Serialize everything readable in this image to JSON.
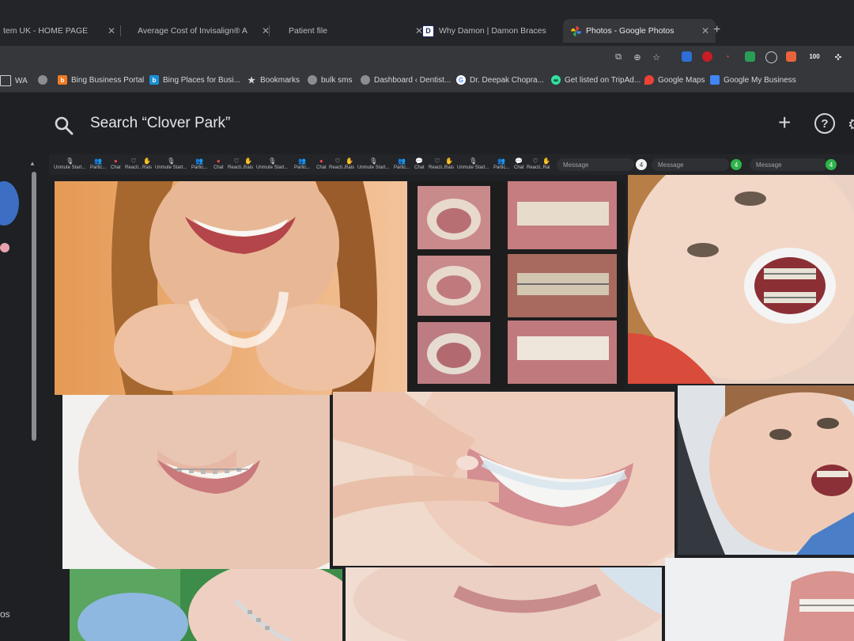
{
  "tabs": [
    {
      "title": "tem UK - HOME PAGE",
      "favicon": "generic"
    },
    {
      "title": "Average Cost of Invisalign® A",
      "favicon": "none"
    },
    {
      "title": "Patient file",
      "favicon": "none"
    },
    {
      "title": "Why Damon | Damon Braces",
      "favicon": "D"
    },
    {
      "title": "Photos - Google Photos",
      "favicon": "photos",
      "active": true
    }
  ],
  "bookmarks": [
    {
      "label": "WA",
      "icon": "folder-icon"
    },
    {
      "label": "",
      "icon": "globe-icon"
    },
    {
      "label": "Bing Business Portal",
      "icon": "bing-icon"
    },
    {
      "label": "Bing Places for Busi...",
      "icon": "bing-icon"
    },
    {
      "label": "Bookmarks",
      "icon": "star-icon"
    },
    {
      "label": "bulk sms",
      "icon": "globe-icon"
    },
    {
      "label": "Dashboard ‹ Dentist...",
      "icon": "globe-icon"
    },
    {
      "label": "Dr. Deepak Chopra...",
      "icon": "google-icon"
    },
    {
      "label": "Get listed on TripAd...",
      "icon": "tripadvisor-icon"
    },
    {
      "label": "Google Maps",
      "icon": "maps-icon"
    },
    {
      "label": "Google My Business",
      "icon": "gmb-icon"
    }
  ],
  "toolbar": {
    "ext_badge": "100"
  },
  "search": {
    "value": "Search “Clover Park”"
  },
  "header_actions": {
    "add": "+",
    "help": "?"
  },
  "meet_strip": {
    "items": [
      "Unmute Start...",
      "Partic...",
      "Chat",
      "Reacti...",
      "Rais",
      "Unmute Start...",
      "Partic...",
      "Chat",
      "Reacti...",
      "Rais",
      "Unmute Start...",
      "Partic...",
      "Chat",
      "Reacti...",
      "Rais",
      "Unmute Start...",
      "Partic...",
      "Chat",
      "Reacti...",
      "Rais",
      "Unmute Start...",
      "Partic...",
      "Chat",
      "Reacti...",
      "Rai"
    ],
    "message_placeholders": [
      "Message",
      "Message",
      "Message"
    ],
    "badges": [
      "4",
      "4",
      "4"
    ]
  },
  "sidebar": {
    "label": "os"
  },
  "photos": [
    {
      "id": "woman-aligner",
      "subject": "smiling woman holding clear aligner"
    },
    {
      "id": "dental-collage",
      "subject": "collage of six dental arch photos"
    },
    {
      "id": "girl-braces-retractor",
      "subject": "girl with braces and cheek retractor"
    },
    {
      "id": "smile-clear-braces",
      "subject": "smile with ceramic braces"
    },
    {
      "id": "aligner-insert",
      "subject": "fingers inserting clear aligner"
    },
    {
      "id": "girl-dentist-chair",
      "subject": "girl with braces in dentist chair"
    },
    {
      "id": "gloves-braces",
      "subject": "gloved hands and braces close-up"
    },
    {
      "id": "smile-closeup",
      "subject": "close-up of smile"
    },
    {
      "id": "dental-model",
      "subject": "dental model with brackets"
    }
  ]
}
